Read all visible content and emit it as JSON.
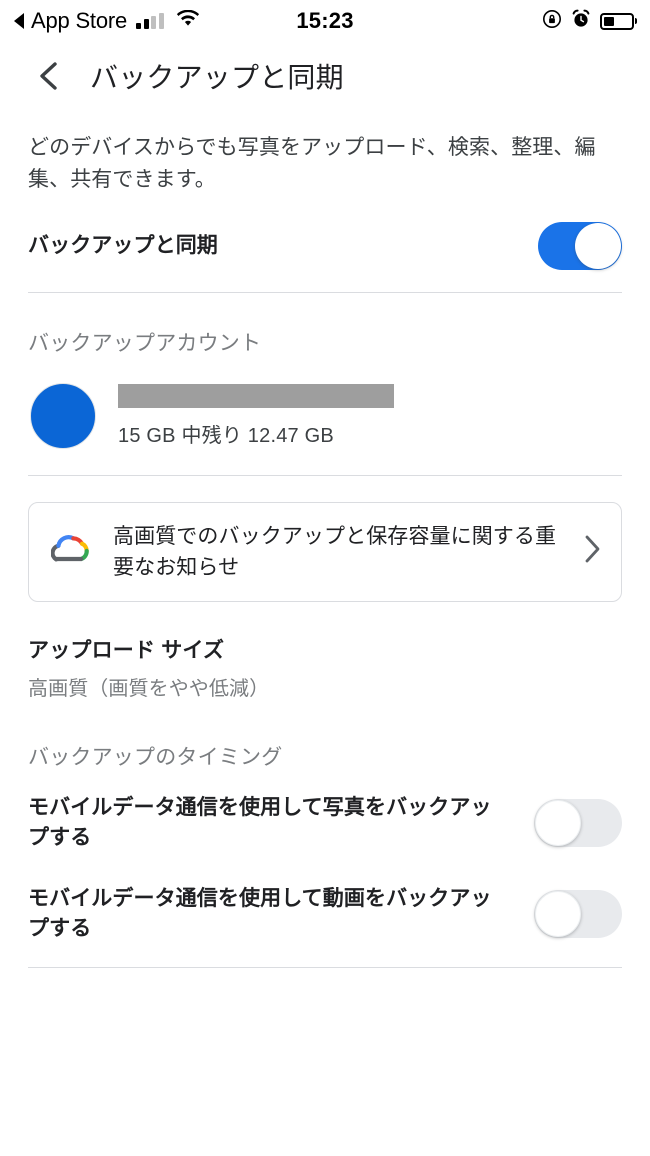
{
  "status_bar": {
    "back_app_label": "App Store",
    "back_arrow_icon": "triangle-left-icon",
    "signal_icon": "cellular-signal-icon",
    "signal_bars_filled": 2,
    "signal_bars_total": 4,
    "wifi_icon": "wifi-icon",
    "time": "15:23",
    "rotation_lock_icon": "rotation-lock-icon",
    "alarm_icon": "alarm-clock-icon",
    "battery_icon": "battery-icon",
    "battery_percent": 40
  },
  "nav": {
    "back_icon": "chevron-left-icon",
    "title": "バックアップと同期"
  },
  "intro": {
    "text": "どのデバイスからでも写真をアップロード、検索、整理、編集、共有できます。"
  },
  "backup_sync_row": {
    "label": "バックアップと同期",
    "toggle_state": "on"
  },
  "backup_account": {
    "section_title": "バックアップアカウント",
    "avatar_icon": "account-avatar",
    "name_redacted": true,
    "storage_text": "15 GB 中残り 12.47 GB"
  },
  "notice_card": {
    "icon": "google-one-cloud-icon",
    "text": "高画質でのバックアップと保存容量に関する重要なお知らせ",
    "chevron_icon": "chevron-right-icon"
  },
  "upload_size": {
    "title": "アップロード サイズ",
    "value": "高画質（画質をやや低減）"
  },
  "backup_timing": {
    "section_title": "バックアップのタイミング",
    "rows": [
      {
        "label": "モバイルデータ通信を使用して写真をバックアップする",
        "toggle_state": "off"
      },
      {
        "label": "モバイルデータ通信を使用して動画をバックアップする",
        "toggle_state": "off"
      }
    ]
  },
  "colors": {
    "accent_blue": "#1a73e8",
    "avatar_blue": "#0b66d6",
    "divider": "#dadce0",
    "toggle_off_track": "#e8eaed",
    "redaction_gray": "#9e9e9e",
    "secondary_text": "#7a7d80",
    "primary_text": "#202124"
  }
}
